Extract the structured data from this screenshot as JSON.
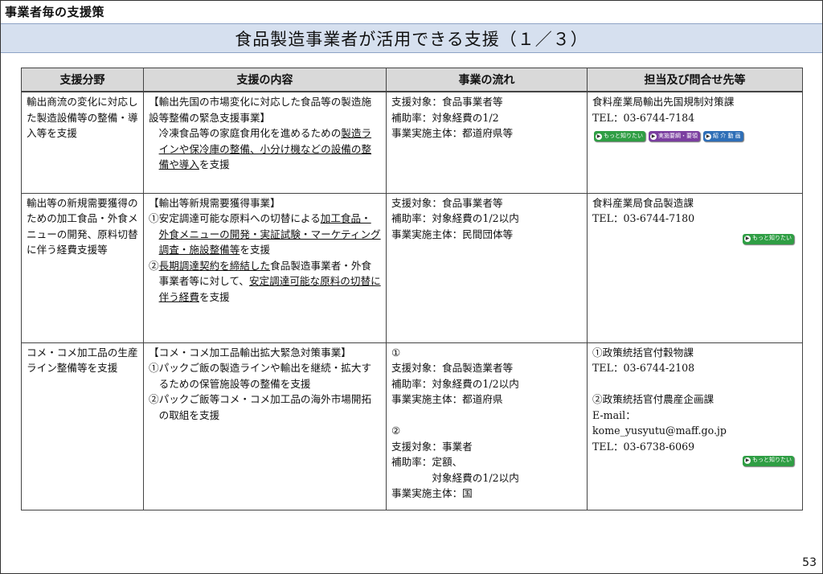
{
  "section_label": "事業者毎の支援策",
  "title": "食品製造事業者が活用できる支援（１／３）",
  "page_number": "53",
  "headers": [
    "支援分野",
    "支援の内容",
    "事業の流れ",
    "担当及び問合せ先等"
  ],
  "rows": [
    {
      "field": "輸出商流の変化に対応した製造設備等の整備・導入等を支援",
      "content": {
        "l1": "【輸出先国の市場変化に対応した食品等の製造施設等整備の緊急支援事業】",
        "l2": "冷凍食品等の家庭食用化を進めるための",
        "l3": "製造ラインや保冷庫の整備、小分け機などの設備の整備や導入",
        "l4": "を支援"
      },
      "flow": [
        "支援対象：食品事業者等",
        "補助率：対象経費の1/2",
        "事業実施主体：都道府県等"
      ],
      "contact": [
        "食料産業局輸出先国規制対策課",
        "TEL：03-6744-7184"
      ],
      "buttons": [
        "もっと知りたい",
        "実施要綱・要領",
        "紹 介 動 画"
      ]
    },
    {
      "field": "輸出等の新規需要獲得のための加工食品・外食メニューの開発、原料切替に伴う経費支援等",
      "content": {
        "l1": "【輸出等新規需要獲得事業】",
        "l2": "①安定調達可能な原料への切替による",
        "l3": "加工食品・外食メニューの開発・実証試験・マーケティング調査・施設整備等",
        "l4": "を支援",
        "l5": "②",
        "l6": "長期調達契約を締結した",
        "l7": "食品製造事業者・外食事業者等に対して、",
        "l8": "安定調達可能な原料の切替に伴う経費",
        "l9": "を支援"
      },
      "flow": [
        "支援対象：食品事業者等",
        "補助率：対象経費の1/2以内",
        "事業実施主体：民間団体等"
      ],
      "contact": [
        "食料産業局食品製造課",
        "TEL：03-6744-7180"
      ],
      "buttons": [
        "もっと知りたい"
      ]
    },
    {
      "field": "コメ・コメ加工品の生産ライン整備等を支援",
      "content": {
        "l1": "【コメ・コメ加工品輸出拡大緊急対策事業】",
        "l2": "①パックご飯の製造ラインや輸出を継続・拡大するための保管施設等の整備を支援",
        "l3": "②パックご飯等コメ・コメ加工品の海外市場開拓の取組を支援"
      },
      "flow": {
        "m1": "①",
        "m1_lines": [
          "支援対象：食品製造業者等",
          "補助率：対象経費の1/2以内",
          "事業実施主体：都道府県"
        ],
        "m2": "②",
        "m2_lines": [
          "支援対象：事業者",
          "補助率：定額、",
          "対象経費の1/2以内",
          "事業実施主体：国"
        ]
      },
      "contact": {
        "c1": "①政策統括官付穀物課",
        "c1_tel": "TEL：03-6744-2108",
        "c2": "②政策統括官付農産企画課",
        "c2_mail_label": "E-mail：",
        "c2_mail": "kome_yusyutu@maff.go.jp",
        "c2_tel": "TEL：03-6738-6069"
      },
      "buttons": [
        "もっと知りたい"
      ]
    }
  ],
  "icons": {
    "button_arrow": "arrow-right-circle-icon"
  },
  "colors": {
    "title_bar": "#d6e0ef",
    "header_bg": "#d9d9d9",
    "btn_green": "#2f9e44",
    "btn_purple": "#7b3fa0",
    "btn_blue": "#2f6fb7"
  }
}
